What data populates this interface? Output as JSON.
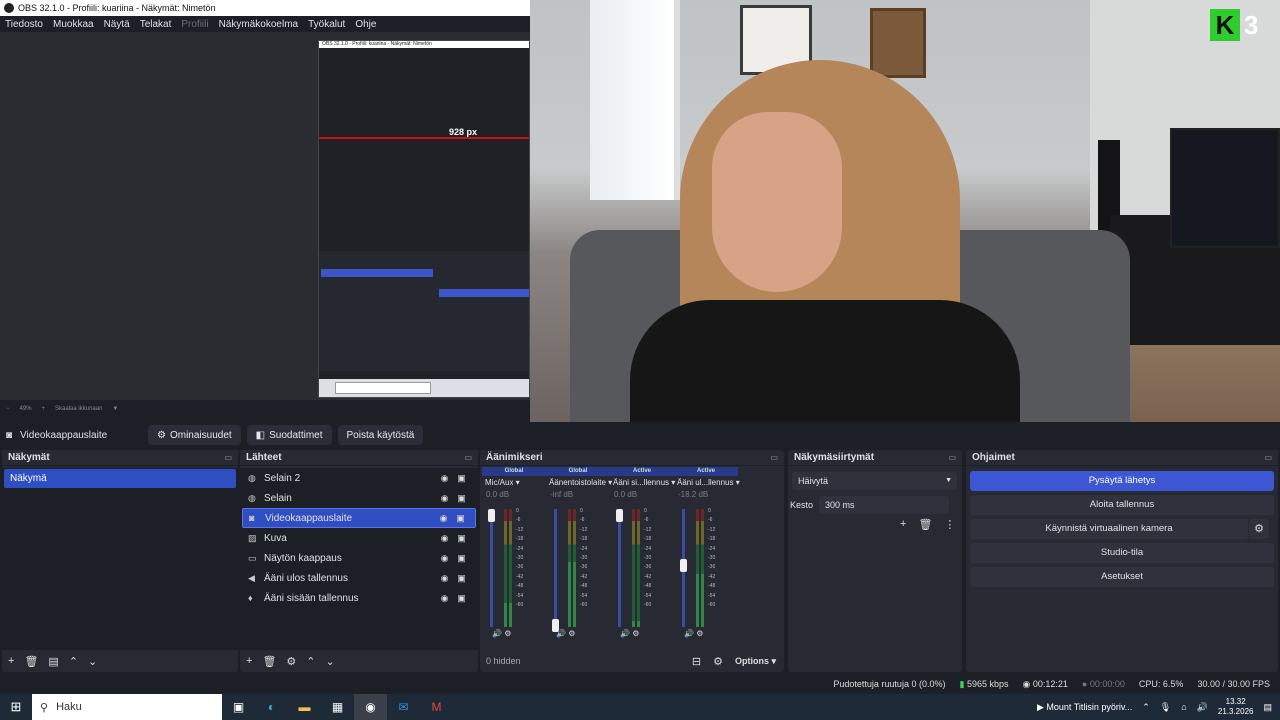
{
  "window": {
    "title": "OBS 32.1.0 - Profiili: kuariina - Näkymät: Nimetön"
  },
  "menu": [
    "Tiedosto",
    "Muokkaa",
    "Näytä",
    "Telakat",
    "Profiili",
    "Näkymäkokoelma",
    "Työkalut",
    "Ohje"
  ],
  "preview": {
    "nested_label": "928 px",
    "zoom": "49%",
    "scale_mode": "Skaalaa ikkunaan",
    "nested_search": "Haku"
  },
  "webcam": {
    "logo_letter": "K",
    "logo_number": "3"
  },
  "source_toolbar": {
    "source_name": "Videokaappauslaite",
    "properties": "Ominaisuudet",
    "filters": "Suodattimet",
    "deactivate": "Poista käytöstä"
  },
  "scenes": {
    "title": "Näkymät",
    "items": [
      "Näkymä"
    ]
  },
  "sources": {
    "title": "Lähteet",
    "items": [
      {
        "name": "Selain 2",
        "icon": "globe-icon"
      },
      {
        "name": "Selain",
        "icon": "globe-icon"
      },
      {
        "name": "Videokaappauslaite",
        "icon": "camera-icon",
        "selected": true
      },
      {
        "name": "Kuva",
        "icon": "image-icon"
      },
      {
        "name": "Näytön kaappaus",
        "icon": "monitor-icon"
      },
      {
        "name": "Ääni ulos tallennus",
        "icon": "speaker-icon"
      },
      {
        "name": "Ääni sisään tallennus",
        "icon": "microphone-icon"
      }
    ]
  },
  "mixer": {
    "title": "Äänimikseri",
    "hidden_label": "0 hidden",
    "options_label": "Options",
    "scale": [
      "0",
      "-6",
      "-12",
      "-18",
      "-24",
      "-30",
      "-36",
      "-42",
      "-48",
      "-54",
      "-60"
    ],
    "channels": [
      {
        "tag": "Global",
        "name": "Mic/Aux",
        "db": "0.0 dB",
        "volume": 1.0,
        "level": 0.2
      },
      {
        "tag": "Global",
        "name": "Äänentoistolaite",
        "db": "-inf dB",
        "volume": 0.0,
        "level": 0.55
      },
      {
        "tag": "Active",
        "name": "Ääni si...llennus",
        "db": "0.0 dB",
        "volume": 1.0,
        "level": 0.05
      },
      {
        "tag": "Active",
        "name": "Ääni ul...llennus",
        "db": "-18.2 dB",
        "volume": 0.55,
        "level": 0.45
      }
    ]
  },
  "transitions": {
    "title": "Näkymäsiirtymät",
    "selected": "Häivytä",
    "duration_label": "Kesto",
    "duration_value": "300 ms"
  },
  "controls": {
    "title": "Ohjaimet",
    "stop_stream": "Pysäytä lähetys",
    "start_recording": "Aloita tallennus",
    "virtual_camera": "Käynnistä virtuaalinen kamera",
    "studio_mode": "Studio-tila",
    "settings": "Asetukset"
  },
  "status": {
    "dropped_frames": "Pudotettuja ruutuja 0 (0.0%)",
    "bitrate": "5965 kbps",
    "stream_time": "00:12:21",
    "record_time": "00:00:00",
    "cpu": "CPU: 6.5%",
    "fps": "30.00 / 30.00 FPS"
  },
  "taskbar": {
    "search_placeholder": "Haku",
    "notification": "Mount Titlisin pyöriv...",
    "time": "13.32",
    "date": "21.3.2026"
  },
  "colors": {
    "accent": "#3d56d4",
    "selection": "#2f4ec2",
    "panel": "#272a33",
    "background": "#1d1f26"
  }
}
